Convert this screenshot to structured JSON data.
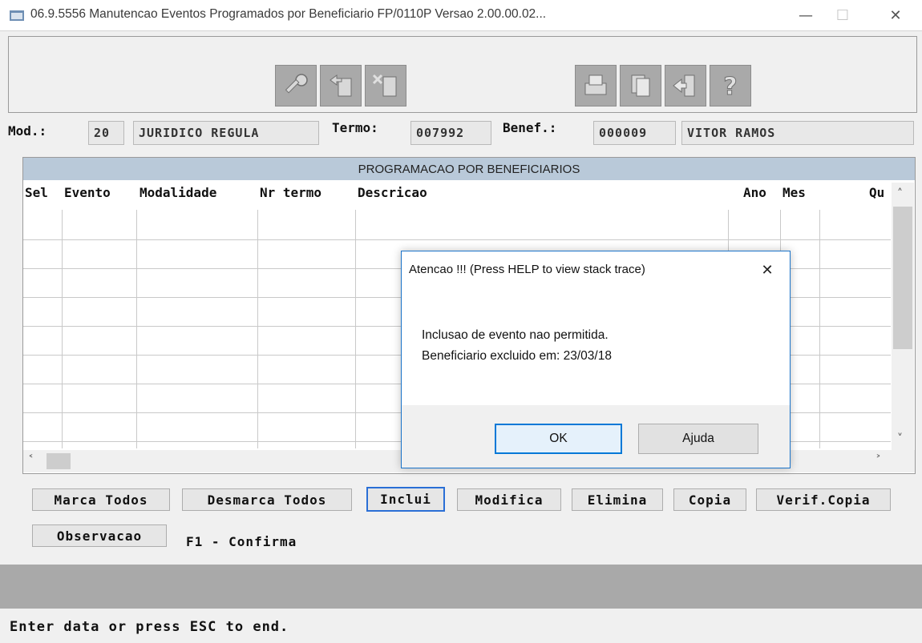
{
  "window": {
    "title": "06.9.5556 Manutencao Eventos Programados por Beneficiario FP/0110P Versao 2.00.00.02...",
    "minimize_glyph": "—",
    "maximize_glyph": "☐",
    "close_glyph": "✕"
  },
  "toolbar": {
    "icons": [
      "key-icon",
      "copy-record-icon",
      "delete-record-icon",
      "print-icon",
      "copy-icon",
      "exit-icon",
      "help-icon"
    ]
  },
  "info": {
    "mod_label": "Mod.:",
    "mod_code": "20",
    "mod_name": "JURIDICO REGULA",
    "termo_label": "Termo:",
    "termo_value": "007992",
    "benef_label": "Benef.:",
    "benef_code": "000009",
    "benef_name": "VITOR RAMOS"
  },
  "grid": {
    "title": "PROGRAMACAO POR BENEFICIARIOS",
    "columns": [
      "Sel",
      "Evento",
      "Modalidade",
      "Nr termo",
      "Descricao",
      "Ano",
      "Mes",
      "Qu"
    ],
    "rows": []
  },
  "buttons": {
    "marca_todos": "Marca Todos",
    "desmarca_todos": "Desmarca Todos",
    "inclui": "Inclui",
    "modifica": "Modifica",
    "elimina": "Elimina",
    "copia": "Copia",
    "verif_copia": "Verif.Copia",
    "observacao": "Observacao",
    "f1_hint": "F1 - Confirma"
  },
  "status": {
    "message": "Enter data or press ESC to end."
  },
  "dialog": {
    "title": "Atencao !!! (Press HELP to view stack trace)",
    "close_glyph": "✕",
    "line1": "Inclusao de evento nao permitida.",
    "line2": "Beneficiario excluido em:  23/03/18",
    "ok_label": "OK",
    "help_label": "Ajuda"
  },
  "colors": {
    "grid_header_bg": "#b9c9d9",
    "focus_border": "#0078d7",
    "status_bar": "#a9a9a9"
  }
}
